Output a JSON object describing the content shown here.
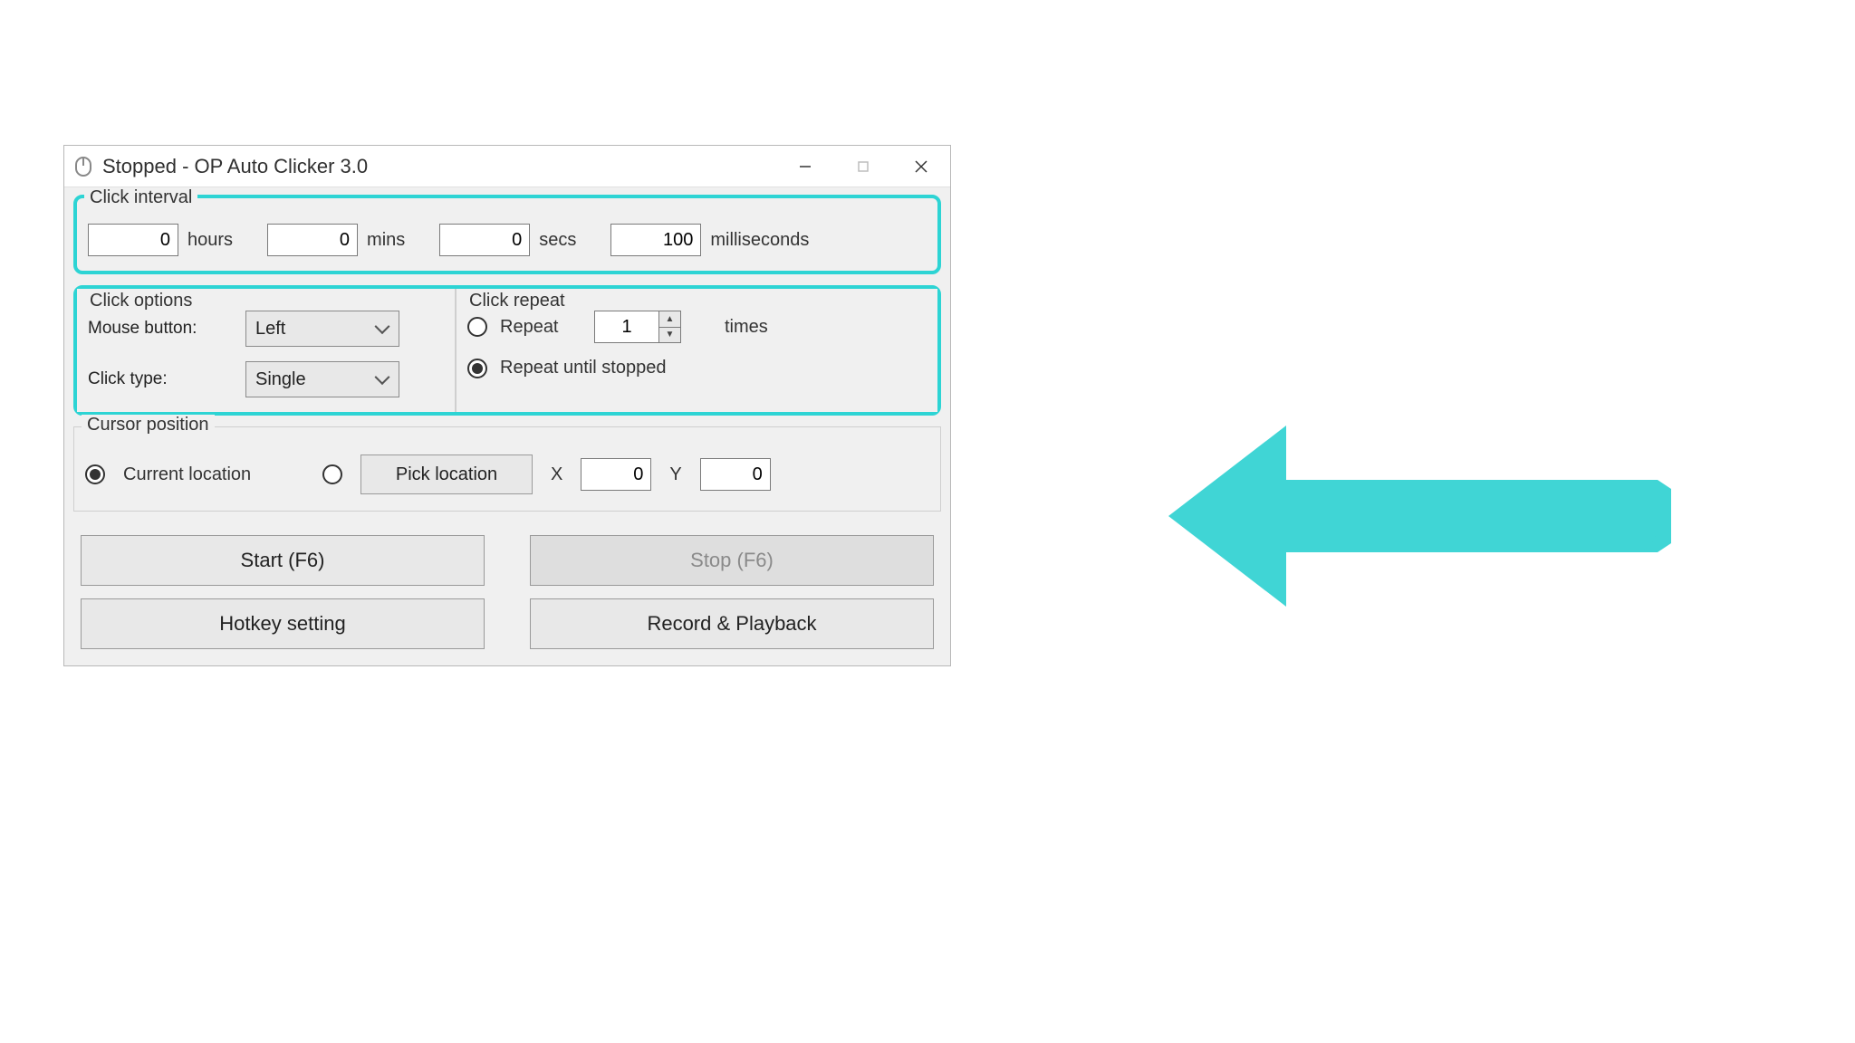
{
  "window": {
    "title": "Stopped - OP Auto Clicker 3.0"
  },
  "interval": {
    "legend": "Click interval",
    "hours": "0",
    "hours_label": "hours",
    "mins": "0",
    "mins_label": "mins",
    "secs": "0",
    "secs_label": "secs",
    "ms": "100",
    "ms_label": "milliseconds"
  },
  "options": {
    "legend": "Click options",
    "mouse_button_label": "Mouse button:",
    "mouse_button_value": "Left",
    "click_type_label": "Click type:",
    "click_type_value": "Single"
  },
  "repeat": {
    "legend": "Click repeat",
    "repeat_label": "Repeat",
    "repeat_count": "1",
    "times_label": "times",
    "until_label": "Repeat until stopped"
  },
  "cursor": {
    "legend": "Cursor position",
    "current_label": "Current location",
    "pick_label": "Pick location",
    "x_label": "X",
    "x_value": "0",
    "y_label": "Y",
    "y_value": "0"
  },
  "buttons": {
    "start": "Start (F6)",
    "stop": "Stop (F6)",
    "hotkey": "Hotkey setting",
    "record": "Record & Playback"
  },
  "colors": {
    "highlight": "#2dd4d4",
    "arrow": "#40d5d5"
  }
}
